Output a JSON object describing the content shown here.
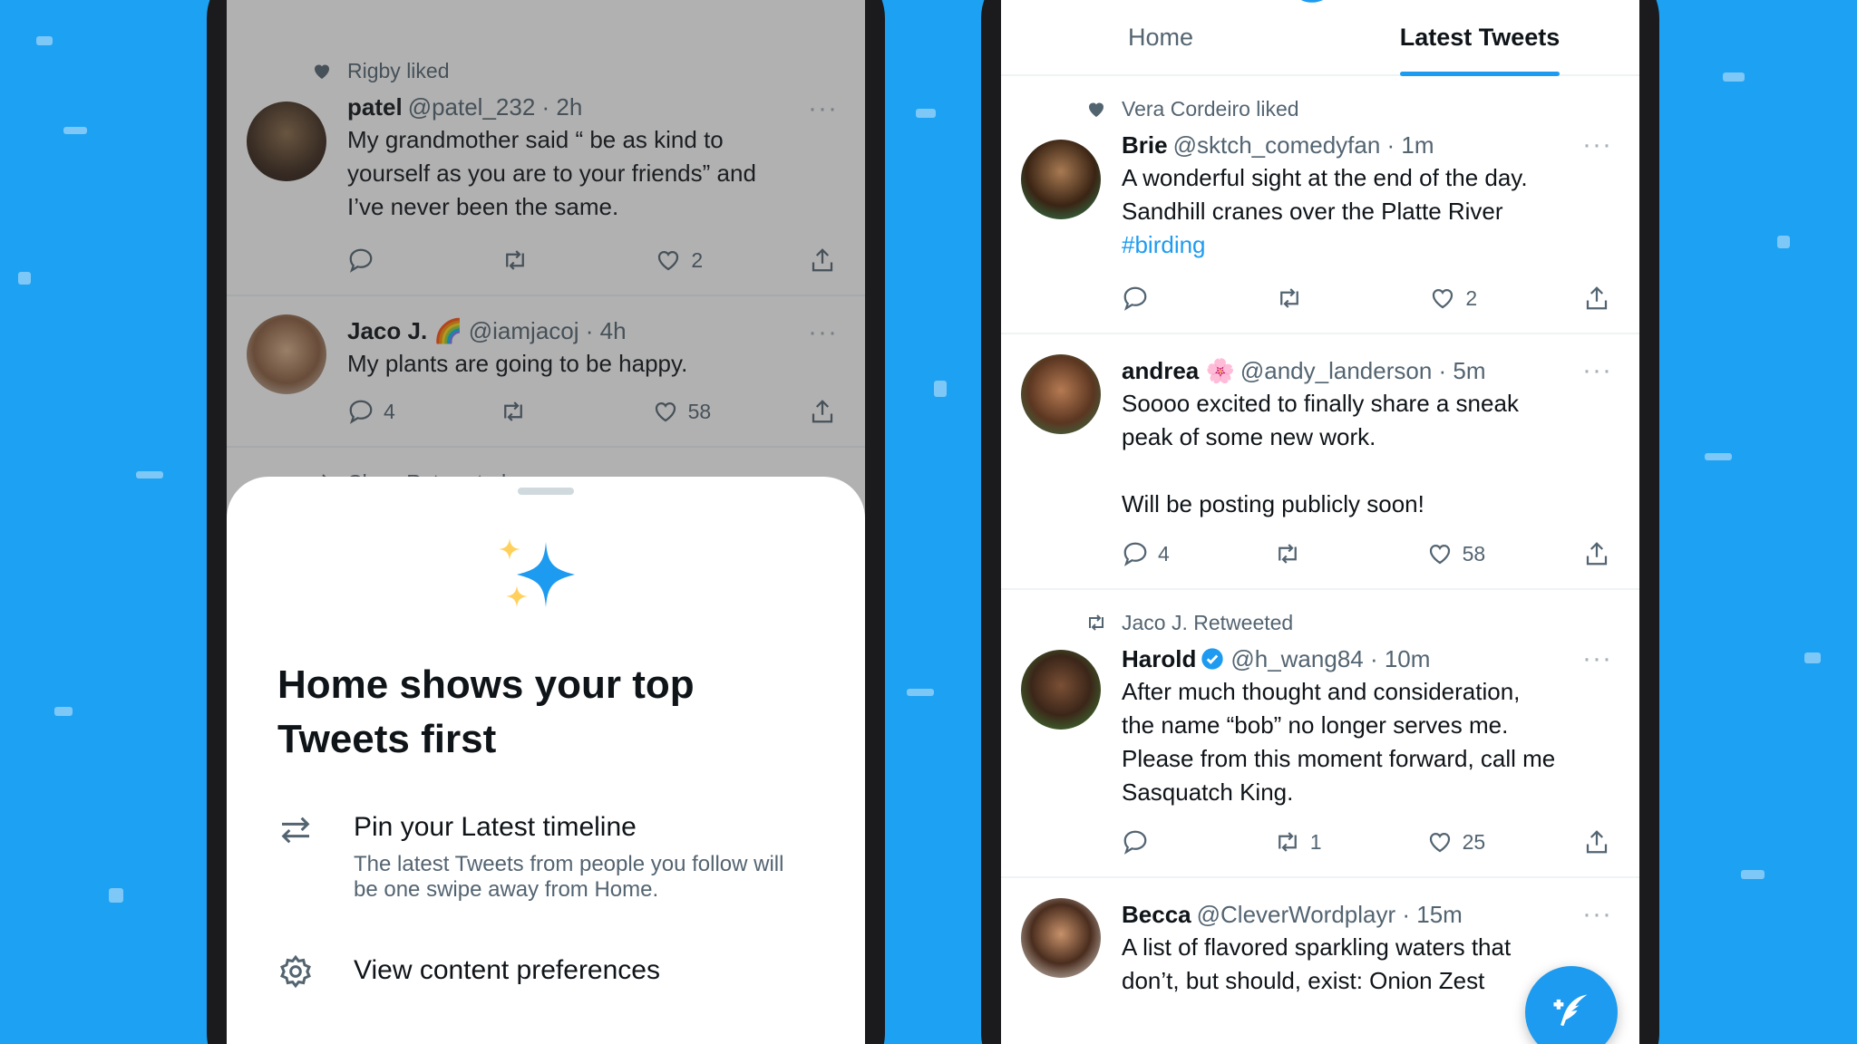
{
  "colors": {
    "background": "#1da1f2",
    "accent": "#1d9bf0",
    "text": "#0f1419",
    "secondary": "#536471"
  },
  "left_phone": {
    "tweets": [
      {
        "social": "Rigby liked",
        "social_icon": "heart-icon",
        "name": "patel",
        "handle": "@patel_232 · 2h",
        "text": "My grandmother said “ be as kind to\nyourself as you are to your friends” and\nI’ve never been the same.",
        "reply": "",
        "retweet": "",
        "like": "2"
      },
      {
        "social": "",
        "name": "Jaco J. 🌈",
        "handle": "@iamjacoj · 4h",
        "text": "My plants are going to be happy.",
        "reply": "4",
        "retweet": "",
        "like": "58"
      },
      {
        "social": "Cleve Retweeted",
        "social_icon": "retweet-icon"
      }
    ],
    "sheet": {
      "title": "Home shows your top Tweets first",
      "option1_title": "Pin your Latest timeline",
      "option1_desc": "The latest Tweets from people you follow will be one swipe away from Home.",
      "option2_title": "View content preferences"
    }
  },
  "right_phone": {
    "tabs": [
      "Home",
      "Latest Tweets"
    ],
    "active_tab": "Latest Tweets",
    "tweets": [
      {
        "social": "Vera Cordeiro liked",
        "social_icon": "heart-icon",
        "name": "Brie",
        "handle": "@sktch_comedyfan · 1m",
        "text": "A wonderful sight at the end of the day.\nSandhill cranes over the Platte River",
        "hashtag": "#birding",
        "reply": "",
        "retweet": "",
        "like": "2"
      },
      {
        "social": "",
        "name": "andrea 🌸",
        "handle": "@andy_landerson · 5m",
        "text": "Soooo excited to finally share a sneak\npeak of some new work.\n\nWill be posting publicly soon!",
        "reply": "4",
        "retweet": "",
        "like": "58"
      },
      {
        "social": "Jaco J. Retweeted",
        "social_icon": "retweet-icon",
        "name": "Harold",
        "verified": true,
        "handle": "@h_wang84 · 10m",
        "text": "After much thought and consideration,\nthe name  “bob” no longer serves me.\nPlease from this moment forward, call me\nSasquatch King.",
        "reply": "",
        "retweet": "1",
        "like": "25"
      },
      {
        "social": "",
        "name": "Becca",
        "handle": "@CleverWordplayr · 15m",
        "text": "A list of flavored sparkling waters that\ndon’t, but should, exist: Onion Zest"
      }
    ]
  }
}
